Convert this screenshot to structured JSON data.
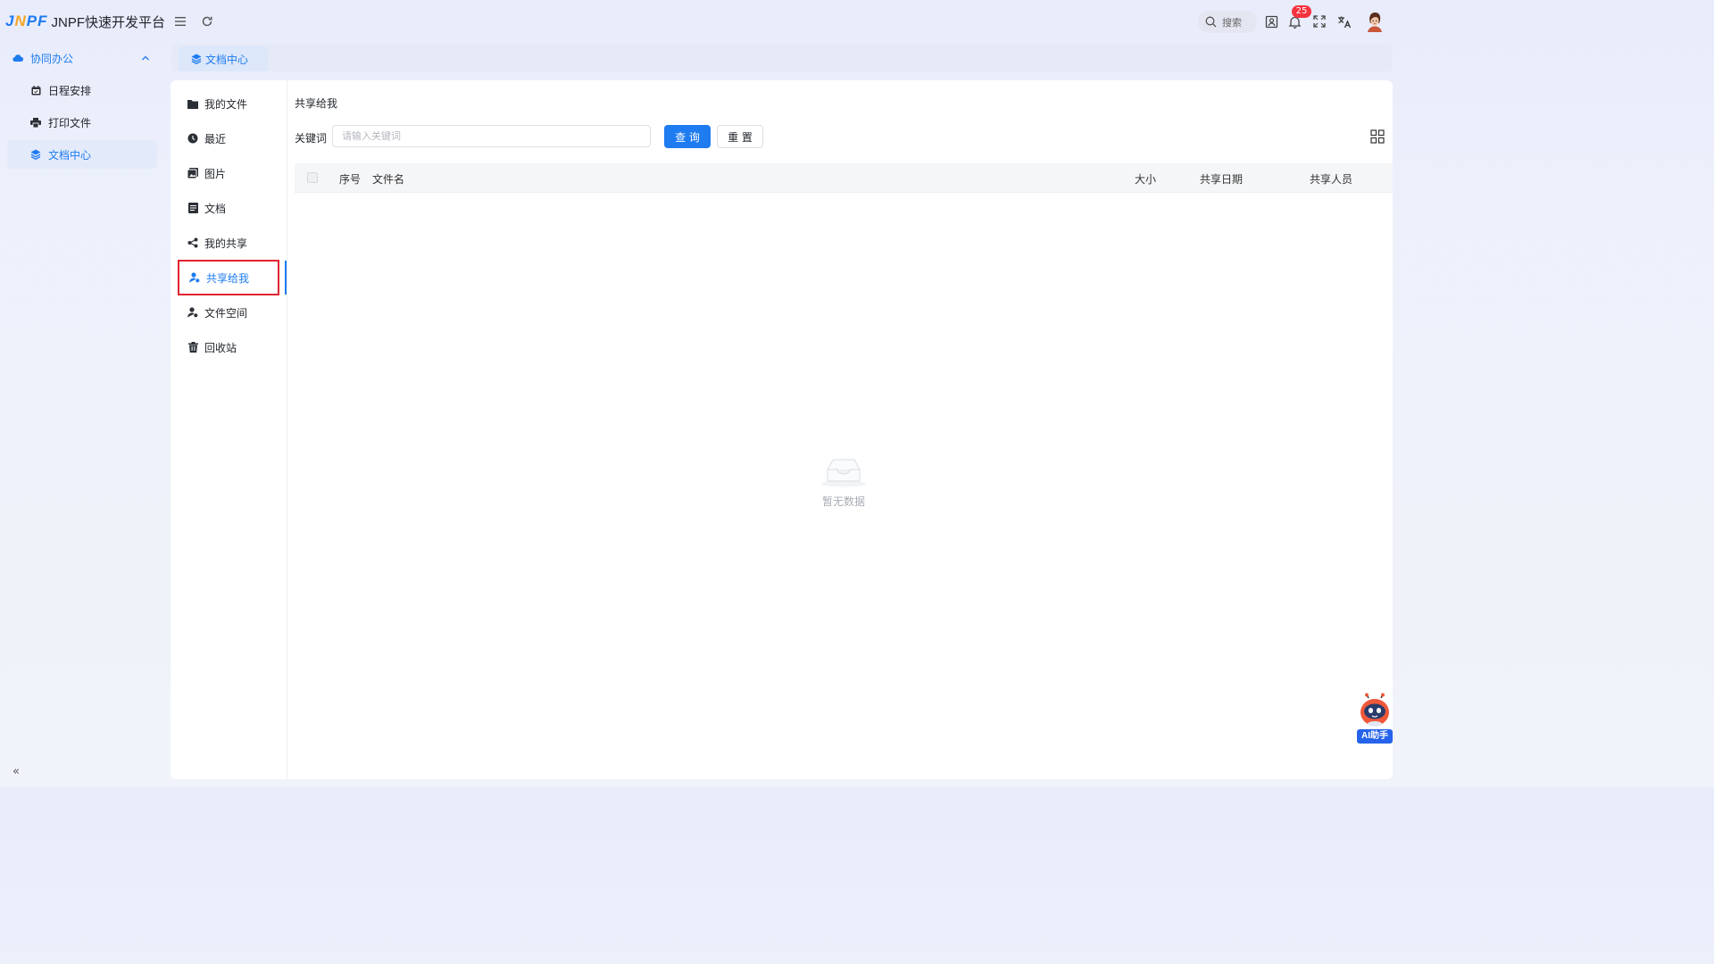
{
  "app": {
    "logo_mark": "JNPF",
    "title": "JNPF快速开发平台"
  },
  "header": {
    "search_placeholder": "搜索",
    "notification_count": "25"
  },
  "sidebar": {
    "group": {
      "label": "协同办公",
      "icon": "cloud-icon"
    },
    "items": [
      {
        "label": "日程安排",
        "icon": "calendar-icon"
      },
      {
        "label": "打印文件",
        "icon": "printer-icon"
      },
      {
        "label": "文档中心",
        "icon": "layers-icon",
        "active": true
      }
    ]
  },
  "tabs": [
    {
      "label": "文档中心",
      "icon": "layers-icon",
      "active": true
    }
  ],
  "doc_nav": {
    "items": [
      {
        "label": "我的文件",
        "icon": "folder-icon"
      },
      {
        "label": "最近",
        "icon": "clock-icon"
      },
      {
        "label": "图片",
        "icon": "image-icon"
      },
      {
        "label": "文档",
        "icon": "document-icon"
      },
      {
        "label": "我的共享",
        "icon": "share-icon"
      },
      {
        "label": "共享给我",
        "icon": "user-shared-icon",
        "active": true
      },
      {
        "label": "文件空间",
        "icon": "user-space-icon"
      },
      {
        "label": "回收站",
        "icon": "trash-icon"
      }
    ]
  },
  "main": {
    "title": "共享给我",
    "keyword_label": "关键词",
    "keyword_placeholder": "请输入关键词",
    "keyword_value": "",
    "query_button": "查 询",
    "reset_button": "重 置",
    "table": {
      "columns": [
        "序号",
        "文件名",
        "大小",
        "共享日期",
        "共享人员"
      ],
      "rows": []
    },
    "empty_text": "暂无数据"
  },
  "ai_assistant": {
    "label": "AI助手"
  },
  "colors": {
    "accent": "#1e7bf0",
    "badge": "#f5333f",
    "highlight_border": "#e0242f"
  }
}
